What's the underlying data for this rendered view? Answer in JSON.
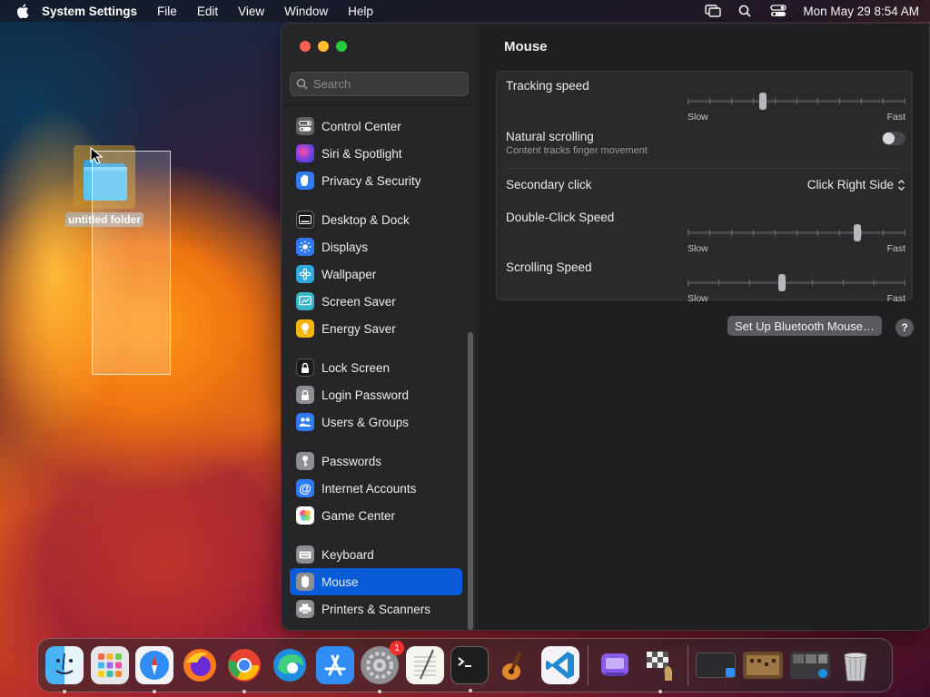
{
  "menubar": {
    "app_name": "System Settings",
    "menus": [
      "File",
      "Edit",
      "View",
      "Window",
      "Help"
    ],
    "datetime": "Mon May 29  8:54 AM"
  },
  "desktop": {
    "folder_label": "untitled folder"
  },
  "sidebar": {
    "search_placeholder": "Search",
    "items": [
      {
        "label": "Control Center",
        "icon": "control-center-icon",
        "color": "#636366"
      },
      {
        "label": "Siri & Spotlight",
        "icon": "siri-icon",
        "color": "#7b3fe4"
      },
      {
        "label": "Privacy & Security",
        "icon": "hand-icon",
        "color": "#2f7bf5"
      },
      {
        "label": "Desktop & Dock",
        "icon": "dock-icon",
        "color": "#1c1c1e"
      },
      {
        "label": "Displays",
        "icon": "sun-icon",
        "color": "#2f7bf5"
      },
      {
        "label": "Wallpaper",
        "icon": "flower-icon",
        "color": "#2fa8e0"
      },
      {
        "label": "Screen Saver",
        "icon": "screen-saver-icon",
        "color": "#37b6c9"
      },
      {
        "label": "Energy Saver",
        "icon": "lightbulb-icon",
        "color": "#f5b50a"
      },
      {
        "label": "Lock Screen",
        "icon": "lock-icon",
        "color": "#1c1c1e"
      },
      {
        "label": "Login Password",
        "icon": "lock-icon",
        "color": "#8e8e93"
      },
      {
        "label": "Users & Groups",
        "icon": "users-icon",
        "color": "#2f7bf5"
      },
      {
        "label": "Passwords",
        "icon": "key-icon",
        "color": "#8e8e93"
      },
      {
        "label": "Internet Accounts",
        "icon": "at-icon",
        "color": "#2f7bf5"
      },
      {
        "label": "Game Center",
        "icon": "game-center-icon",
        "color": "#ffffff"
      },
      {
        "label": "Keyboard",
        "icon": "keyboard-icon",
        "color": "#8e8e93"
      },
      {
        "label": "Mouse",
        "icon": "mouse-icon",
        "color": "#8e8e93"
      },
      {
        "label": "Printers & Scanners",
        "icon": "printer-icon",
        "color": "#8e8e93"
      }
    ],
    "active_item": "Mouse"
  },
  "content": {
    "title": "Mouse",
    "tracking_speed": {
      "label": "Tracking speed",
      "slow": "Slow",
      "fast": "Fast",
      "value": 0.34
    },
    "natural_scrolling": {
      "label": "Natural scrolling",
      "sub": "Content tracks finger movement",
      "enabled": false
    },
    "secondary_click": {
      "label": "Secondary click",
      "value": "Click Right Side"
    },
    "double_click_speed": {
      "label": "Double-Click Speed",
      "slow": "Slow",
      "fast": "Fast",
      "value": 0.79
    },
    "scrolling_speed": {
      "label": "Scrolling Speed",
      "slow": "Slow",
      "fast": "Fast",
      "value": 0.43
    },
    "bluetooth_button": "Set Up Bluetooth Mouse…",
    "help_button": "?"
  },
  "dock": {
    "apps": [
      {
        "name": "finder-icon"
      },
      {
        "name": "launchpad-icon"
      },
      {
        "name": "safari-icon"
      },
      {
        "name": "firefox-icon"
      },
      {
        "name": "chrome-icon"
      },
      {
        "name": "edge-icon"
      },
      {
        "name": "app-store-icon"
      },
      {
        "name": "system-settings-icon"
      },
      {
        "name": "textedit-icon"
      },
      {
        "name": "terminal-icon"
      },
      {
        "name": "garageband-icon"
      },
      {
        "name": "vscode-icon"
      }
    ],
    "settings_badge": "1",
    "recent": [
      {
        "name": "apple-configurator-icon"
      },
      {
        "name": "chess-icon"
      }
    ],
    "minimized": [
      {
        "name": "minimized-window-1"
      },
      {
        "name": "minimized-window-2"
      },
      {
        "name": "minimized-window-3"
      }
    ],
    "trash": "trash-icon"
  },
  "colors": {
    "accent": "#0a5bd8",
    "window_bg": "#1f1f21",
    "sidebar_bg": "#262628"
  }
}
